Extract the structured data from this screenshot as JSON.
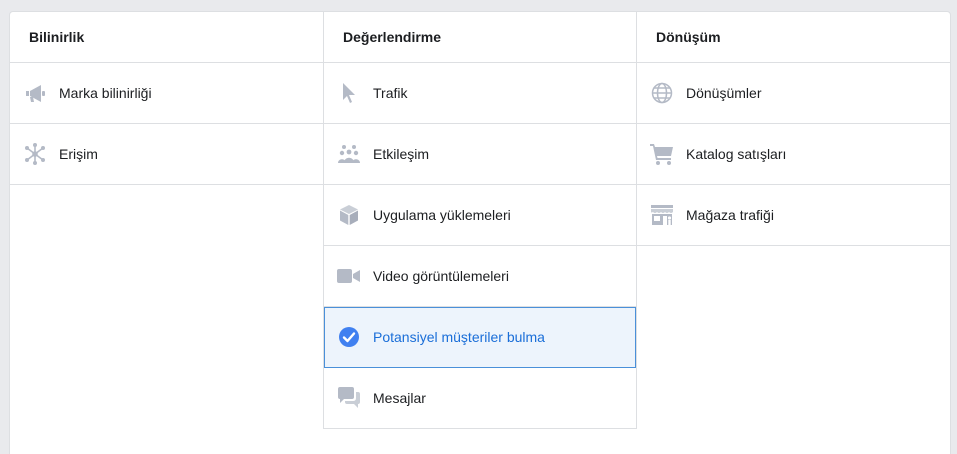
{
  "columns": [
    {
      "header": "Bilinirlik",
      "items": [
        {
          "label": "Marka bilinirliği",
          "icon": "megaphone-icon"
        },
        {
          "label": "Erişim",
          "icon": "network-icon"
        }
      ]
    },
    {
      "header": "Değerlendirme",
      "items": [
        {
          "label": "Trafik",
          "icon": "cursor-icon"
        },
        {
          "label": "Etkileşim",
          "icon": "people-icon"
        },
        {
          "label": "Uygulama yüklemeleri",
          "icon": "box-icon"
        },
        {
          "label": "Video görüntülemeleri",
          "icon": "video-camera-icon"
        },
        {
          "label": "Potansiyel müşteriler bulma",
          "icon": "check-circle-icon",
          "selected": true
        },
        {
          "label": "Mesajlar",
          "icon": "chat-bubbles-icon"
        }
      ]
    },
    {
      "header": "Dönüşüm",
      "items": [
        {
          "label": "Dönüşümler",
          "icon": "globe-icon"
        },
        {
          "label": "Katalog satışları",
          "icon": "cart-icon"
        },
        {
          "label": "Mağaza trafiği",
          "icon": "store-icon"
        }
      ]
    }
  ],
  "colors": {
    "icon_gray": "#b4bac6",
    "selected_blue": "#1a6ed8",
    "selected_bg": "#edf4fc",
    "check_blue": "#4080f0"
  }
}
